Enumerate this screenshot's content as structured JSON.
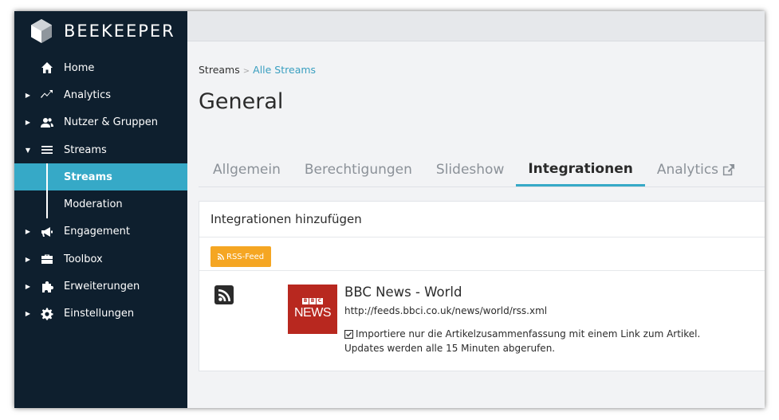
{
  "app": {
    "brand": "BEEKEEPER"
  },
  "sidebar": {
    "items": [
      {
        "label": "Home",
        "icon": "home-icon",
        "caret": ""
      },
      {
        "label": "Analytics",
        "icon": "analytics-icon",
        "caret": "▶"
      },
      {
        "label": "Nutzer & Gruppen",
        "icon": "users-icon",
        "caret": "▶"
      },
      {
        "label": "Streams",
        "icon": "list-icon",
        "caret": "▼"
      },
      {
        "label": "Engagement",
        "icon": "megaphone-icon",
        "caret": "▶"
      },
      {
        "label": "Toolbox",
        "icon": "toolbox-icon",
        "caret": "▶"
      },
      {
        "label": "Erweiterungen",
        "icon": "puzzle-icon",
        "caret": "▶"
      },
      {
        "label": "Einstellungen",
        "icon": "gear-icon",
        "caret": "▶"
      }
    ],
    "subitems": [
      {
        "label": "Streams",
        "active": true
      },
      {
        "label": "Moderation",
        "active": false
      }
    ]
  },
  "breadcrumb": {
    "root": "Streams",
    "separator": ">",
    "current": "Alle Streams"
  },
  "page": {
    "title": "General"
  },
  "tabs": [
    {
      "label": "Allgemein"
    },
    {
      "label": "Berechtigungen"
    },
    {
      "label": "Slideshow"
    },
    {
      "label": "Integrationen"
    },
    {
      "label": "Analytics"
    }
  ],
  "integrations": {
    "heading": "Integrationen hinzufügen",
    "add_button": "RSS-Feed",
    "feed": {
      "title": "BBC News - World",
      "url": "http://feeds.bbci.co.uk/news/world/rss.xml",
      "thumb_letters": [
        "B",
        "B",
        "C"
      ],
      "thumb_text": "NEWS",
      "note_line1": "Importiere nur die Artikelzusammenfassung mit einem Link zum Artikel.",
      "note_line2": "Updates werden alle 15 Minuten abgerufen."
    }
  },
  "colors": {
    "sidebar": "#0e1f2e",
    "accent": "#36a9c7",
    "rss": "#f5a623",
    "bbc": "#b8281f"
  }
}
